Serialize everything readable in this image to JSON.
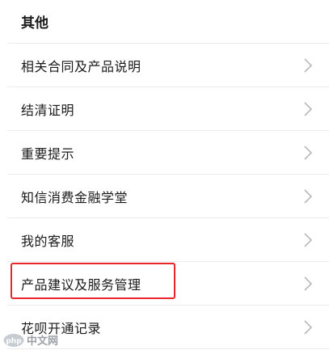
{
  "section": {
    "title": "其他"
  },
  "items": [
    {
      "label": "相关合同及产品说明"
    },
    {
      "label": "结清证明"
    },
    {
      "label": "重要提示"
    },
    {
      "label": "知信消费金融学堂"
    },
    {
      "label": "我的客服"
    },
    {
      "label": "产品建议及服务管理"
    },
    {
      "label": "花呗开通记录"
    }
  ],
  "icons": {
    "chevron": "chevron-right-icon"
  },
  "colors": {
    "highlight": "#e8262b",
    "chevron": "#b8b8b8",
    "divider": "#ececec"
  },
  "watermark": {
    "text": "中文网"
  }
}
